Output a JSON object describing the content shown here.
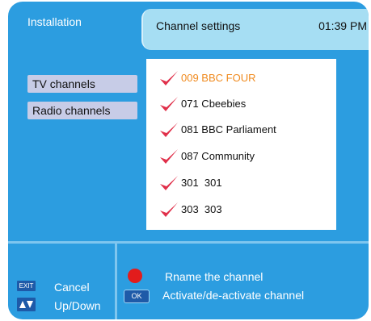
{
  "header": {
    "section_tab": "Installation",
    "title": "Channel settings",
    "time": "01:39 PM"
  },
  "sidebar": {
    "items": [
      {
        "label": "TV channels"
      },
      {
        "label": "Radio channels"
      }
    ]
  },
  "channels": [
    {
      "label": "009 BBC FOUR",
      "checked": true,
      "selected": true
    },
    {
      "label": "071 Cbeebies",
      "checked": true,
      "selected": false
    },
    {
      "label": "081 BBC Parliament",
      "checked": true,
      "selected": false
    },
    {
      "label": "087 Community",
      "checked": true,
      "selected": false
    },
    {
      "label": "301  301",
      "checked": true,
      "selected": false
    },
    {
      "label": "303  303",
      "checked": true,
      "selected": false
    }
  ],
  "footer": {
    "exit_key": "EXIT",
    "cancel_label": "Cancel",
    "updown_label": "Up/Down",
    "ok_key": "OK",
    "rename_label": "Rname the channel",
    "activate_label": "Activate/de-activate channel"
  },
  "colors": {
    "background": "#2c9de0",
    "header_tab": "#a6def3",
    "selected_text": "#f08a1e",
    "checkmark": "#e0304a",
    "red_key": "#e21c1c",
    "key_blue": "#1e5aa8"
  },
  "icons": {
    "check": "checkmark-icon",
    "red_button": "red-button-icon",
    "updown": "up-down-arrows-icon"
  }
}
